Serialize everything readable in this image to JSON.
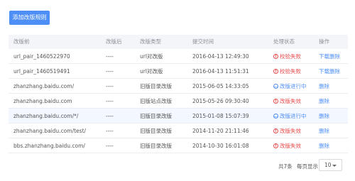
{
  "toolbar": {
    "add_label": "添加改版规则"
  },
  "table": {
    "headers": [
      "改版前",
      "改版后",
      "改版类型",
      "提交时间",
      "处理状态",
      "操作"
    ],
    "rows": [
      {
        "before": "url_pair_1460522970",
        "after": "----",
        "type": "url对改版",
        "time": "2016-04-13 12:49:30",
        "status": "校验失败",
        "status_kind": "fail",
        "action": "下载删除"
      },
      {
        "before": "url_pair_1460519491",
        "after": "----",
        "type": "url对改版",
        "time": "2016-04-13 11:51:31",
        "status": "校验失败",
        "status_kind": "fail",
        "action": "下载删除"
      },
      {
        "before": "zhanzhang.baidu.com/",
        "after": "----",
        "type": "旧版目录改版",
        "time": "2015-06-05 14:33:05",
        "status": "改版进行中",
        "status_kind": "progress",
        "action": "删除"
      },
      {
        "before": "zhanzhang.baidu.com",
        "after": "----",
        "type": "旧版站点改版",
        "time": "2015-05-26 09:30:40",
        "status": "改版失效",
        "status_kind": "fail",
        "action": "删除"
      },
      {
        "before": "zhanzhang.baidu.com/*/",
        "after": "----",
        "type": "旧版目录改版",
        "time": "2015-01-08 15:07:39",
        "status": "改版进行中",
        "status_kind": "progress",
        "action": "删除"
      },
      {
        "before": "zhanzhang.baidu.com/test/",
        "after": "----",
        "type": "旧版目录改版",
        "time": "2014-11-20 21:11:46",
        "status": "改版失效",
        "status_kind": "fail",
        "action": "删除"
      },
      {
        "before": "bbs.zhanzhang.baidu.com/",
        "after": "----",
        "type": "旧版目录改版",
        "time": "2014-10-30 16:01:08",
        "status": "改版失效",
        "status_kind": "fail",
        "action": "删除"
      }
    ]
  },
  "pagination": {
    "total": "共7条",
    "per_page_label": "每页显示：",
    "per_page_value": "10"
  },
  "colors": {
    "accent": "#4e8ef7",
    "fail": "#e84a4a",
    "header_bg": "#f4f5f8",
    "row_highlight": "#f3f7ff"
  }
}
